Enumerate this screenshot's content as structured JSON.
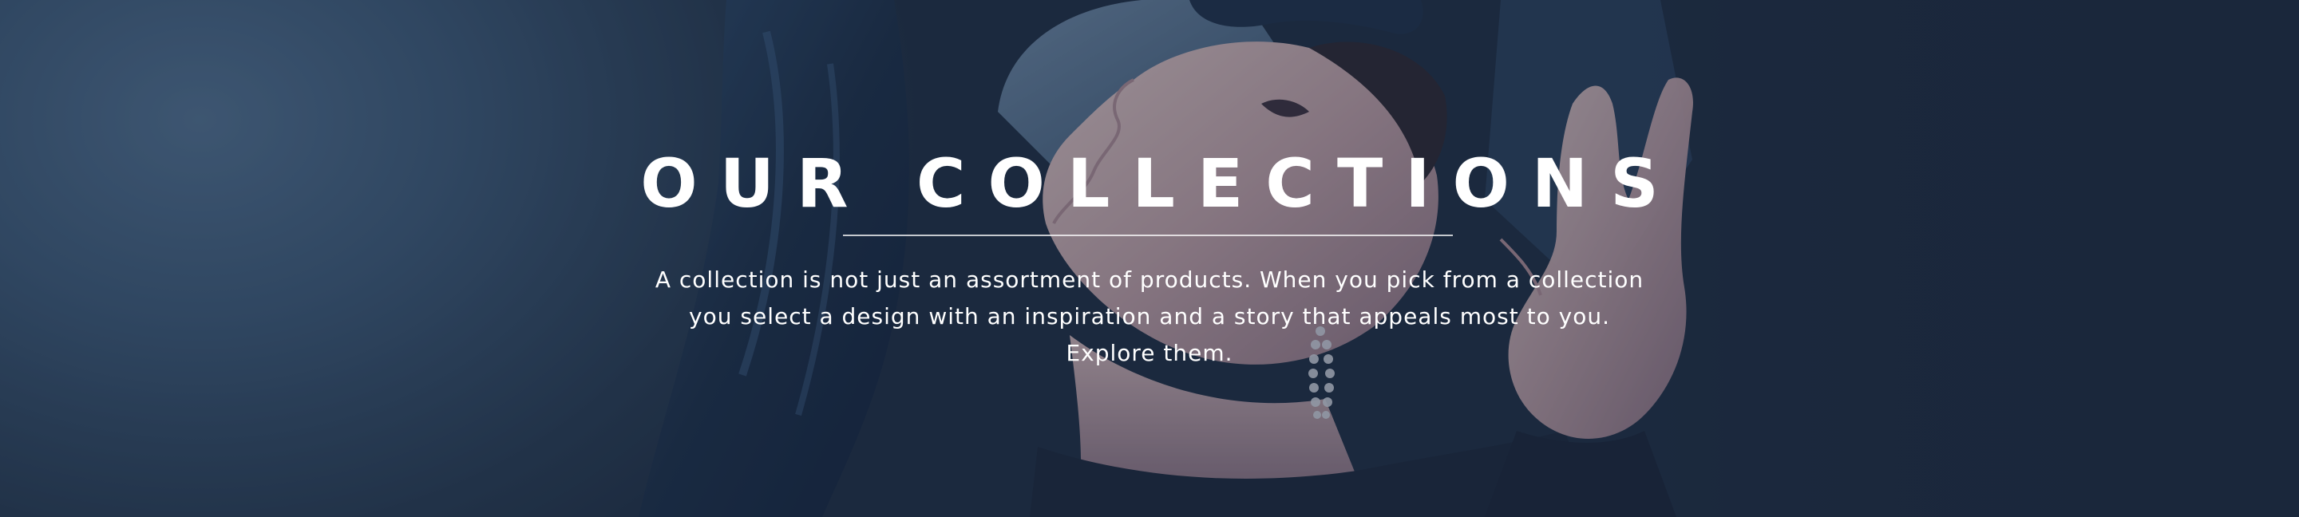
{
  "hero": {
    "title": "OUR COLLECTIONS",
    "description_lines": [
      "A collection is not just an assortment of products. When you pick from a collection",
      "you select a design with an inspiration and a story that appeals most to you.",
      "Explore them."
    ],
    "background_image": "woman-with-earrings-photo",
    "overlay_color": "#18263a",
    "text_color": "#ffffff"
  }
}
